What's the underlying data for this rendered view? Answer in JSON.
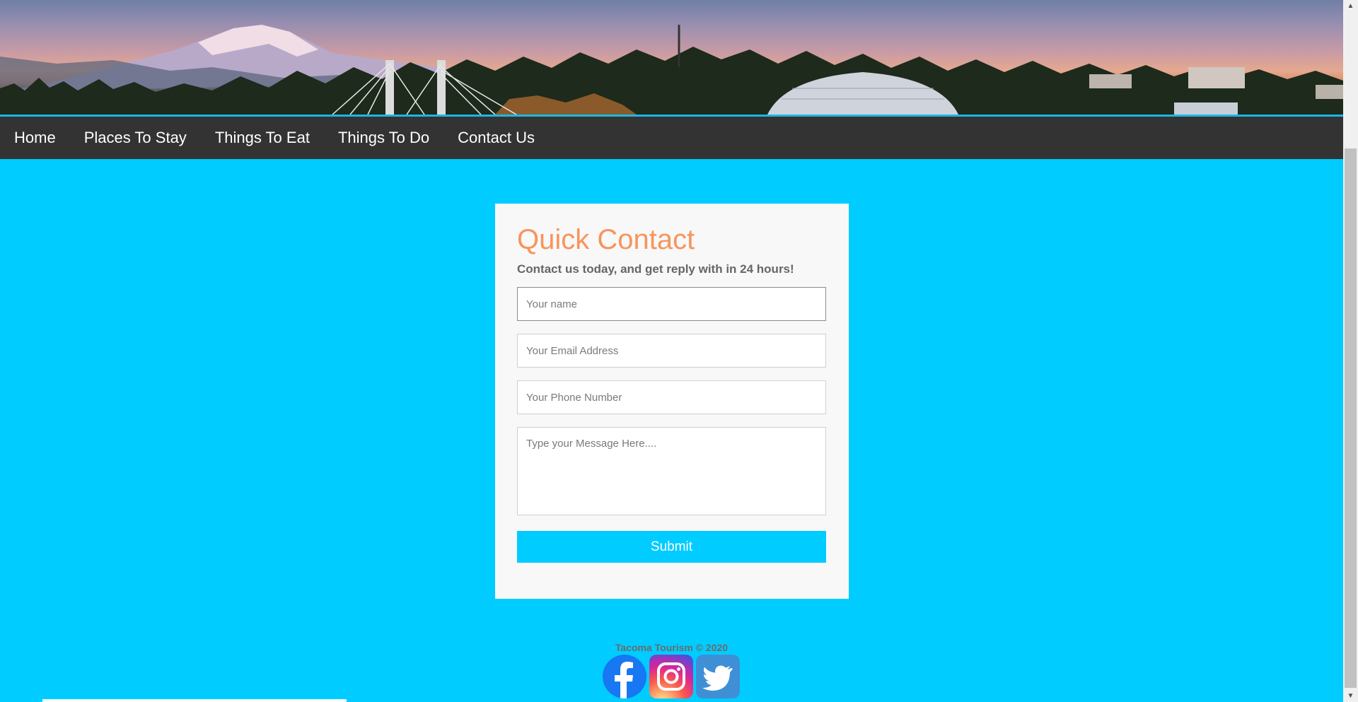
{
  "nav": {
    "items": [
      {
        "label": "Home"
      },
      {
        "label": "Places To Stay"
      },
      {
        "label": "Things To Eat"
      },
      {
        "label": "Things To Do"
      },
      {
        "label": "Contact Us"
      }
    ]
  },
  "form": {
    "title": "Quick Contact",
    "subtitle": "Contact us today, and get reply with in 24 hours!",
    "name_placeholder": "Your name",
    "email_placeholder": "Your Email Address",
    "phone_placeholder": "Your Phone Number",
    "message_placeholder": "Type your Message Here....",
    "submit_label": "Submit"
  },
  "footer": {
    "copyright": "Tacoma Tourism © 2020",
    "social": [
      "facebook-icon",
      "instagram-icon",
      "twitter-icon"
    ]
  },
  "colors": {
    "page_background": "#00ccff",
    "nav_background": "#333333",
    "title_accent": "#f7955b",
    "submit_button": "#00ccff"
  }
}
